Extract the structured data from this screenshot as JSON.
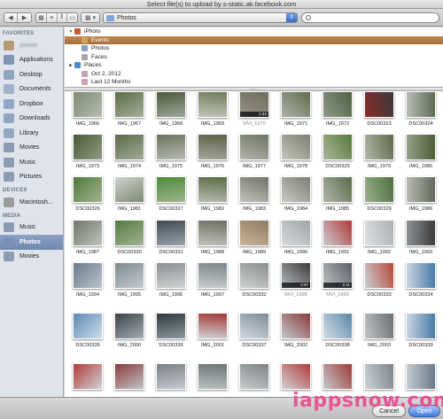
{
  "window": {
    "title": "Select file(s) to upload by s-static.ak.facebook.com"
  },
  "toolbar": {
    "nav_back": "◀",
    "nav_forward": "▶",
    "view_icon_view": "▦",
    "view_list_view": "≡",
    "view_column_view": "⫴",
    "view_cover_flow": "▭",
    "arrange_label": "▦ ▾",
    "location": "Photos",
    "location_arrows": "⇕",
    "search_placeholder": ""
  },
  "sidebar": {
    "sections": [
      {
        "heading": "FAVORITES",
        "items": [
          {
            "label": "ipwww",
            "icon": "user-home-icon",
            "color": "#b59a74",
            "blurred": true
          },
          {
            "label": "Applications",
            "icon": "applications-icon",
            "color": "#7f95b4"
          },
          {
            "label": "Desktop",
            "icon": "desktop-icon",
            "color": "#8fa4c1"
          },
          {
            "label": "Documents",
            "icon": "documents-icon",
            "color": "#9fb0c8"
          },
          {
            "label": "Dropbox",
            "icon": "dropbox-icon",
            "color": "#8fa6c6"
          },
          {
            "label": "Downloads",
            "icon": "downloads-icon",
            "color": "#8fa4c1"
          },
          {
            "label": "Library",
            "icon": "library-folder-icon",
            "color": "#93a7c3"
          },
          {
            "label": "Movies",
            "icon": "movies-icon",
            "color": "#8b9bb2"
          },
          {
            "label": "Music",
            "icon": "music-icon",
            "color": "#8b9bb2"
          },
          {
            "label": "Pictures",
            "icon": "pictures-icon",
            "color": "#8b9bb2"
          }
        ]
      },
      {
        "heading": "DEVICES",
        "items": [
          {
            "label": "Macintosh...",
            "icon": "hard-drive-icon",
            "color": "#9a9a9a"
          }
        ]
      },
      {
        "heading": "MEDIA",
        "items": [
          {
            "label": "Music",
            "icon": "music-icon",
            "color": "#8b9bb2"
          },
          {
            "label": "Photos",
            "icon": "photos-icon",
            "color": "#7a8fb3",
            "selected": true
          },
          {
            "label": "Movies",
            "icon": "movies-icon",
            "color": "#8b9bb2"
          }
        ]
      }
    ]
  },
  "browser": {
    "rows": [
      {
        "label": "iPhoto",
        "tri": "▼",
        "indent": 0,
        "color": "#c85a3c"
      },
      {
        "label": "Events",
        "tri": "",
        "indent": 8,
        "color": "#d4a25a",
        "selected": true
      },
      {
        "label": "Photos",
        "tri": "",
        "indent": 8,
        "color": "#8aa0bf"
      },
      {
        "label": "Faces",
        "tri": "",
        "indent": 8,
        "color": "#a6a6a6"
      },
      {
        "label": "Places",
        "tri": "▶",
        "indent": 0,
        "color": "#4a8ad0"
      },
      {
        "label": "Oct 2, 2012",
        "tri": "",
        "indent": 8,
        "color": "#c8a0b8"
      },
      {
        "label": "Last 12 Months",
        "tri": "",
        "indent": 8,
        "color": "#c8a0b8"
      }
    ]
  },
  "photos": {
    "rows": [
      [
        {
          "label": "IMG_1966",
          "c": [
            "#7d8a70",
            "#b7bcb0"
          ]
        },
        {
          "label": "IMG_1967",
          "c": [
            "#5b6b45",
            "#a7ae9c"
          ]
        },
        {
          "label": "IMG_1968",
          "c": [
            "#4d5a3a",
            "#9da59a"
          ]
        },
        {
          "label": "IMG_1969",
          "c": [
            "#6e7b5a",
            "#c2c6bc"
          ]
        },
        {
          "label": "MVI_1970",
          "c": [
            "#68705a",
            "#9a8f8b"
          ],
          "video": "1:42",
          "gray": true
        },
        {
          "label": "IMG_1971",
          "c": [
            "#5e6b4b",
            "#aeb2a8"
          ]
        },
        {
          "label": "IMG_1972",
          "c": [
            "#4f6040",
            "#8e9b8b"
          ]
        },
        {
          "label": "DSC00323",
          "c": [
            "#3a3a3a",
            "#8b2b2b"
          ]
        },
        {
          "label": "DSC00324",
          "c": [
            "#5c6a52",
            "#b9bdb5"
          ]
        }
      ],
      [
        {
          "label": "IMG_1973",
          "c": [
            "#4a5a38",
            "#8f9a83"
          ]
        },
        {
          "label": "IMG_1974",
          "c": [
            "#5a6a47",
            "#a2aa99"
          ]
        },
        {
          "label": "IMG_1975",
          "c": [
            "#6b745e",
            "#b8b8b0"
          ]
        },
        {
          "label": "IMG_1976",
          "c": [
            "#5b6248",
            "#a5a59b"
          ]
        },
        {
          "label": "IMG_1977",
          "c": [
            "#6d7463",
            "#b4b4ab"
          ]
        },
        {
          "label": "IMG_1978",
          "c": [
            "#7a7f70",
            "#c5c5bd"
          ]
        },
        {
          "label": "DSC00325",
          "c": [
            "#587a3a",
            "#aab69a"
          ]
        },
        {
          "label": "IMG_1979",
          "c": [
            "#5f6a49",
            "#b3b7a8"
          ]
        },
        {
          "label": "IMG_1980",
          "c": [
            "#4e5d3a",
            "#95a08b"
          ]
        }
      ],
      [
        {
          "label": "DSC00326",
          "c": [
            "#4f7a3a",
            "#a1b38f"
          ]
        },
        {
          "label": "IMG_1981",
          "c": [
            "#d0d2d0",
            "#7d8a70"
          ]
        },
        {
          "label": "DSC00327",
          "c": [
            "#4b8a3a",
            "#9fb58b"
          ]
        },
        {
          "label": "IMG_1982",
          "c": [
            "#5b6b45",
            "#b6bab0"
          ]
        },
        {
          "label": "IMG_1983",
          "c": [
            "#6f7465",
            "#c2c3bd"
          ]
        },
        {
          "label": "IMG_1984",
          "c": [
            "#7a7e73",
            "#c9cac4"
          ]
        },
        {
          "label": "IMG_1985",
          "c": [
            "#5a6b4a",
            "#b1b7aa"
          ]
        },
        {
          "label": "DSC00329",
          "c": [
            "#4e6e3c",
            "#9cb090"
          ]
        },
        {
          "label": "IMG_1986",
          "c": [
            "#63695a",
            "#b9bab3"
          ]
        }
      ],
      [
        {
          "label": "IMG_1987",
          "c": [
            "#6f766a",
            "#bfc2ba"
          ]
        },
        {
          "label": "DSC00330",
          "c": [
            "#547a40",
            "#a0b492"
          ]
        },
        {
          "label": "DSC00331",
          "c": [
            "#3e4a52",
            "#9aa3aa"
          ]
        },
        {
          "label": "IMG_1988",
          "c": [
            "#6b7060",
            "#c0c2ba"
          ]
        },
        {
          "label": "IMG_1989",
          "c": [
            "#8c7a62",
            "#c9b59a"
          ]
        },
        {
          "label": "IMG_1990",
          "c": [
            "#9ea4a8",
            "#d8dadb"
          ]
        },
        {
          "label": "IMG_1991",
          "c": [
            "#b33a3a",
            "#c8ccd0"
          ]
        },
        {
          "label": "IMG_1992",
          "c": [
            "#aab0b4",
            "#dfe1e2"
          ]
        },
        {
          "label": "IMG_1993",
          "c": [
            "#3b3b3b",
            "#8e9296"
          ]
        }
      ],
      [
        {
          "label": "IMG_1994",
          "c": [
            "#6a7a8a",
            "#b9c4cc"
          ]
        },
        {
          "label": "IMG_1995",
          "c": [
            "#7c8a90",
            "#c5cbcf"
          ]
        },
        {
          "label": "IMG_1996",
          "c": [
            "#8a8e90",
            "#d1d3d4"
          ]
        },
        {
          "label": "IMG_1997",
          "c": [
            "#7b8588",
            "#c8ccce"
          ]
        },
        {
          "label": "DSC00332",
          "c": [
            "#8a8d8e",
            "#cfd1d2"
          ]
        },
        {
          "label": "MVI_1998",
          "c": [
            "#3a3a3a",
            "#b8bcbf"
          ],
          "video": "0:07",
          "gray": true
        },
        {
          "label": "MVI_1999",
          "c": [
            "#5a6066",
            "#c0c4c7"
          ],
          "video": "2:11",
          "gray": true
        },
        {
          "label": "DSC00333",
          "c": [
            "#b84a3a",
            "#c9cdd0"
          ]
        },
        {
          "label": "DSC00334",
          "c": [
            "#4a7aa8",
            "#c9d7e2"
          ]
        }
      ],
      [
        {
          "label": "DSC00335",
          "c": [
            "#5a8ab4",
            "#d0dce6"
          ]
        },
        {
          "label": "IMG_2000",
          "c": [
            "#3a4448",
            "#a4acb0"
          ]
        },
        {
          "label": "DSC00336",
          "c": [
            "#2f3a40",
            "#8e999e"
          ]
        },
        {
          "label": "IMG_2001",
          "c": [
            "#a23a36",
            "#cfd2d4"
          ]
        },
        {
          "label": "DSC00337",
          "c": [
            "#7b8b98",
            "#d3d9de"
          ]
        },
        {
          "label": "IMG_2002",
          "c": [
            "#8a3a3a",
            "#c4c8ca"
          ]
        },
        {
          "label": "DSC00338",
          "c": [
            "#5e88aa",
            "#d2dde6"
          ]
        },
        {
          "label": "IMG_2003",
          "c": [
            "#6a6e70",
            "#c1c4c6"
          ]
        },
        {
          "label": "DSC00339",
          "c": [
            "#4a7aa6",
            "#cad7e2"
          ]
        }
      ],
      [
        {
          "label": "",
          "c": [
            "#b33a3a",
            "#cfd2d4"
          ]
        },
        {
          "label": "",
          "c": [
            "#8a3a3a",
            "#c0c4c7"
          ]
        },
        {
          "label": "",
          "c": [
            "#7a8088",
            "#c6cacd"
          ]
        },
        {
          "label": "",
          "c": [
            "#6b7474",
            "#bcc1c2"
          ]
        },
        {
          "label": "",
          "c": [
            "#7c8286",
            "#c9cccd"
          ]
        },
        {
          "label": "",
          "c": [
            "#b23a3a",
            "#d1d3d4"
          ]
        },
        {
          "label": "",
          "c": [
            "#a03a3a",
            "#c5c9cc"
          ]
        },
        {
          "label": "",
          "c": [
            "#7a858c",
            "#cdd1d4"
          ]
        },
        {
          "label": "",
          "c": [
            "#6a7a86",
            "#c4ccd2"
          ]
        }
      ]
    ]
  },
  "footer": {
    "cancel_label": "Cancel",
    "open_label": "Open"
  },
  "watermark": "iappsnow.com"
}
